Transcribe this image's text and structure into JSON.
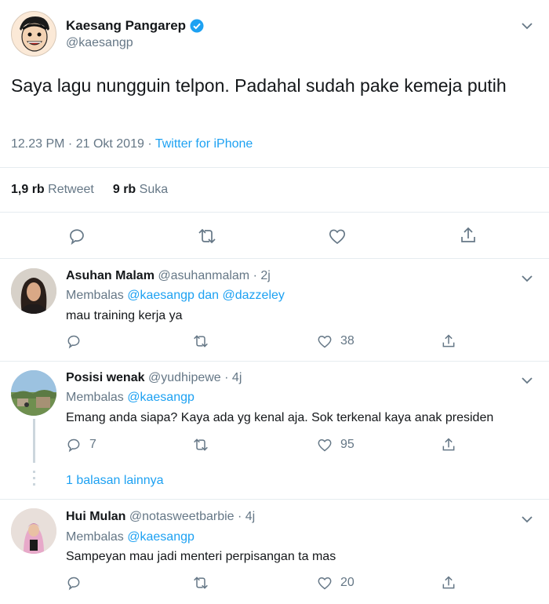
{
  "main_tweet": {
    "author_name": "Kaesang Pangarep",
    "handle": "@kaesangp",
    "text": "Saya lagu nungguin telpon. Padahal sudah pake kemeja putih",
    "time": "12.23 PM · 21 Okt 2019",
    "source": "Twitter for iPhone",
    "retweet_count": "1,9 rb",
    "retweet_label": "Retweet",
    "like_count": "9 rb",
    "like_label": "Suka"
  },
  "replies": [
    {
      "author_name": "Asuhan Malam",
      "handle": "@asuhanmalam",
      "age": "· 2j",
      "replying_prefix": "Membalas",
      "replying_to_1": "@kaesangp",
      "replying_and": "dan",
      "replying_to_2": "@dazzeley",
      "text": "mau training kerja ya",
      "reply_count": "",
      "retweet_count": "",
      "like_count": "38"
    },
    {
      "author_name": "Posisi wenak",
      "handle": "@yudhipewe",
      "age": "· 4j",
      "replying_prefix": "Membalas",
      "replying_to_1": "@kaesangp",
      "text": "Emang anda siapa? Kaya ada yg kenal aja. Sok terkenal kaya anak presiden",
      "reply_count": "7",
      "retweet_count": "",
      "like_count": "95",
      "more_replies": "1 balasan lainnya"
    },
    {
      "author_name": "Hui Mulan",
      "handle": "@notasweetbarbie",
      "age": "· 4j",
      "replying_prefix": "Membalas",
      "replying_to_1": "@kaesangp",
      "text": "Sampeyan mau jadi menteri perpisangan ta mas",
      "reply_count": "",
      "retweet_count": "",
      "like_count": "20"
    }
  ],
  "colors": {
    "accent": "#1da1f2",
    "muted": "#657786",
    "text": "#14171a",
    "divider": "#e6ecf0"
  },
  "icons": [
    "verified-badge-icon",
    "chevron-down-icon",
    "reply-icon",
    "retweet-icon",
    "like-icon",
    "share-icon"
  ]
}
